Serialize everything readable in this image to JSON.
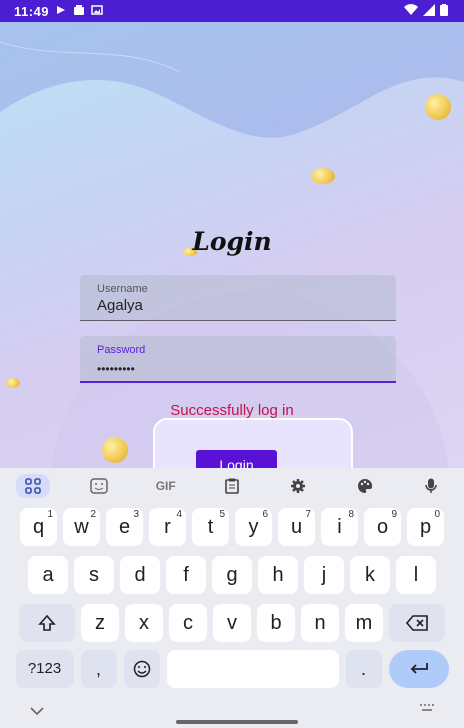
{
  "status_bar": {
    "time": "11:49"
  },
  "login": {
    "title": "Login",
    "username_label": "Username",
    "username_value": "Agalya",
    "password_label": "Password",
    "password_value": "•••••••••",
    "success_message": "Successfully log in",
    "login_button": "Login"
  },
  "keyboard": {
    "toolbar": {
      "gif_label": "GIF"
    },
    "row1": [
      {
        "key": "q",
        "hint": "1"
      },
      {
        "key": "w",
        "hint": "2"
      },
      {
        "key": "e",
        "hint": "3"
      },
      {
        "key": "r",
        "hint": "4"
      },
      {
        "key": "t",
        "hint": "5"
      },
      {
        "key": "y",
        "hint": "6"
      },
      {
        "key": "u",
        "hint": "7"
      },
      {
        "key": "i",
        "hint": "8"
      },
      {
        "key": "o",
        "hint": "9"
      },
      {
        "key": "p",
        "hint": "0"
      }
    ],
    "row2": [
      "a",
      "s",
      "d",
      "f",
      "g",
      "h",
      "j",
      "k",
      "l"
    ],
    "row3": [
      "z",
      "x",
      "c",
      "v",
      "b",
      "n",
      "m"
    ],
    "row4": {
      "symbols": "?123",
      "comma": ",",
      "period": "."
    }
  },
  "colors": {
    "status_bar": "#4b1fd1",
    "accent": "#5a11d6",
    "success_text": "#c2134a"
  }
}
